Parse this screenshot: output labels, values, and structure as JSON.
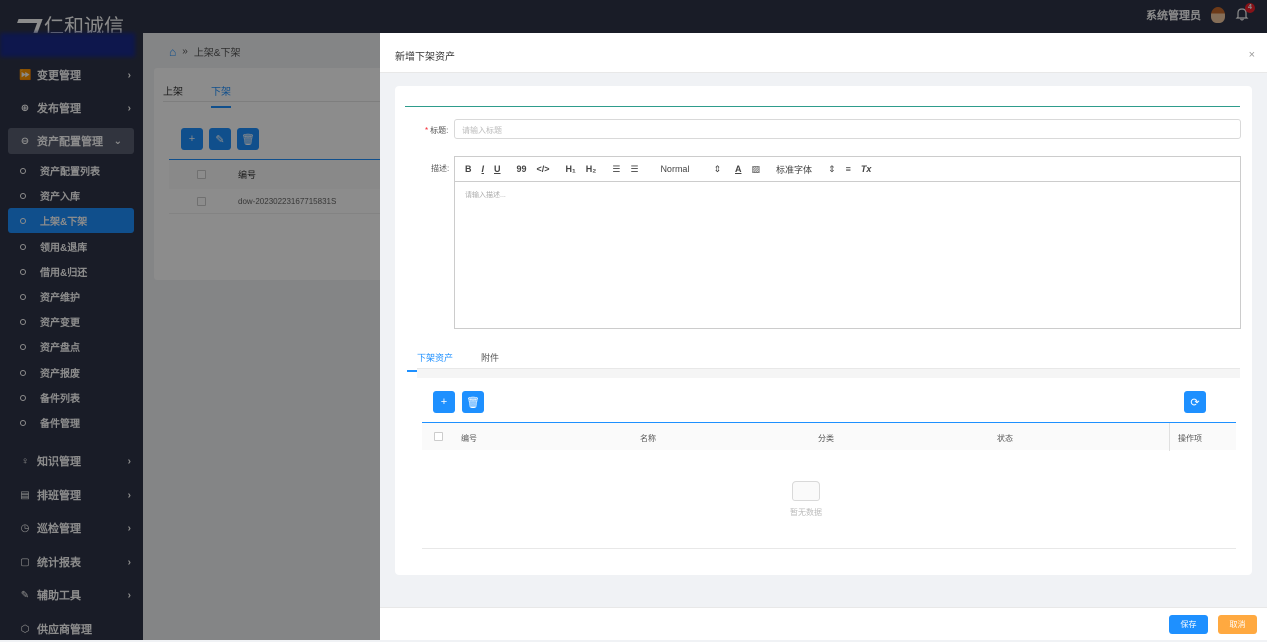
{
  "app": {
    "title": "仁和诚信"
  },
  "header": {
    "user_name": "系统管理员",
    "notification_count": "4"
  },
  "sidebar": {
    "groups": [
      {
        "label": "变更管理",
        "icon": "fast-forward-icon"
      },
      {
        "label": "发布管理",
        "icon": "globe-icon"
      },
      {
        "label": "资产配置管理",
        "icon": "storage-icon"
      }
    ],
    "sub_items": [
      {
        "label": "资产配置列表"
      },
      {
        "label": "资产入库"
      },
      {
        "label": "上架&下架"
      },
      {
        "label": "领用&退库"
      },
      {
        "label": "借用&归还"
      },
      {
        "label": "资产维护"
      },
      {
        "label": "资产变更"
      },
      {
        "label": "资产盘点"
      },
      {
        "label": "资产报废"
      },
      {
        "label": "备件列表"
      },
      {
        "label": "备件管理"
      }
    ],
    "bottom_groups": [
      {
        "label": "知识管理"
      },
      {
        "label": "排班管理"
      },
      {
        "label": "巡检管理"
      },
      {
        "label": "统计报表"
      },
      {
        "label": "辅助工具"
      },
      {
        "label": "供应商管理"
      }
    ]
  },
  "breadcrumb": {
    "sep": "»",
    "current": "上架&下架"
  },
  "bg_page": {
    "tabs": [
      "上架",
      "下架"
    ],
    "col_number": "编号",
    "row_number": "dow-20230223167715831S"
  },
  "drawer": {
    "title": "新增下架资产",
    "close": "×",
    "title_label": "标题:",
    "title_placeholder": "请输入标题",
    "desc_label": "描述:",
    "desc_placeholder": "请输入描述...",
    "toolbar": {
      "bold": "B",
      "italic": "I",
      "underline": "U",
      "quote": "99",
      "code": "</>",
      "h1": "H₁",
      "h2": "H₂",
      "ol": "☰",
      "ul": "☰",
      "size": "Normal",
      "font": "标准字体",
      "align": "≡",
      "clear": "Tx"
    },
    "tabs": [
      "下架资产",
      "附件"
    ],
    "columns": {
      "number": "编号",
      "name": "名称",
      "category": "分类",
      "status": "状态",
      "ops": "操作项"
    },
    "empty_text": "暂无数据",
    "save": "保存",
    "cancel": "取消"
  }
}
